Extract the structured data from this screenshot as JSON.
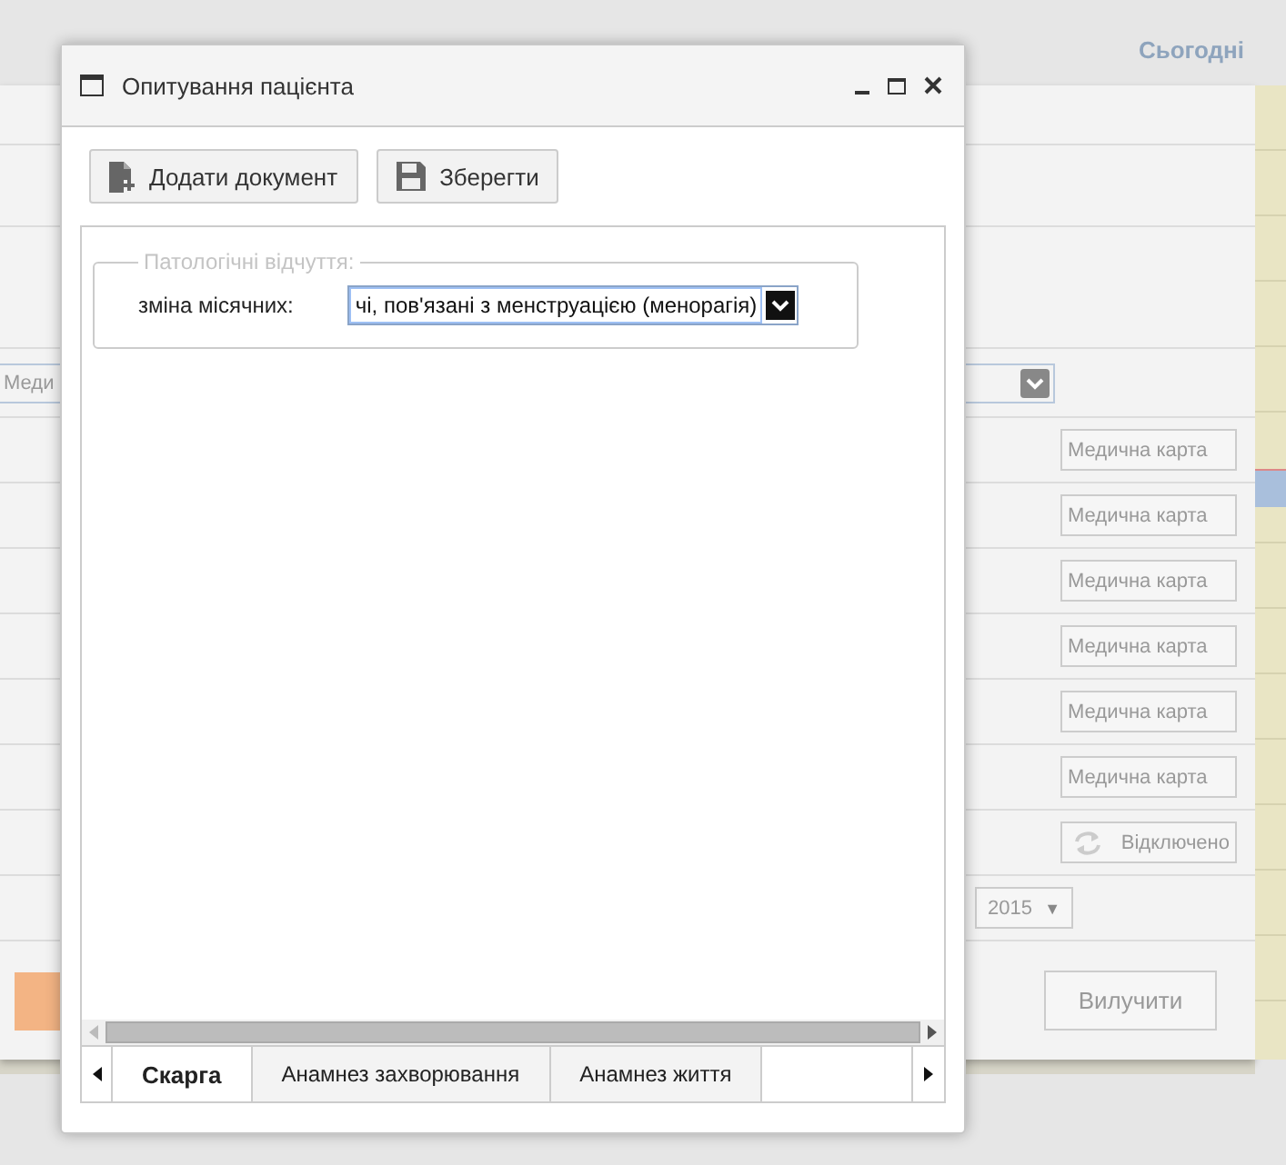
{
  "background": {
    "today_link": "Сьогодні",
    "left_field": "Меди",
    "rows": [
      {
        "kind": "combo"
      },
      {
        "kind": "card",
        "label": "Медична карта"
      },
      {
        "kind": "card",
        "label": "Медична карта"
      },
      {
        "kind": "card",
        "label": "Медична карта"
      },
      {
        "kind": "card",
        "label": "Медична карта"
      },
      {
        "kind": "card",
        "label": "Медична карта"
      },
      {
        "kind": "card",
        "label": "Медична карта"
      },
      {
        "kind": "toggle",
        "label": "Відключено"
      },
      {
        "kind": "year",
        "value": "2015",
        "arrow": "▼"
      }
    ],
    "delete_button": "Вилучити"
  },
  "dialog": {
    "title": "Опитування пацієнта",
    "toolbar": [
      {
        "kind": "add",
        "label": "Додати документ"
      },
      {
        "kind": "save",
        "label": "Зберегти"
      }
    ],
    "fieldset": {
      "legend": "Патологічні відчуття:",
      "label": "зміна місячних:",
      "value": "чі, пов'язані з менструацією (менорагія)"
    },
    "tabs": [
      {
        "label": "Скарга",
        "selected": true
      },
      {
        "label": "Анамнез захворювання",
        "selected": false
      },
      {
        "label": "Анамнез життя",
        "selected": false
      }
    ]
  }
}
